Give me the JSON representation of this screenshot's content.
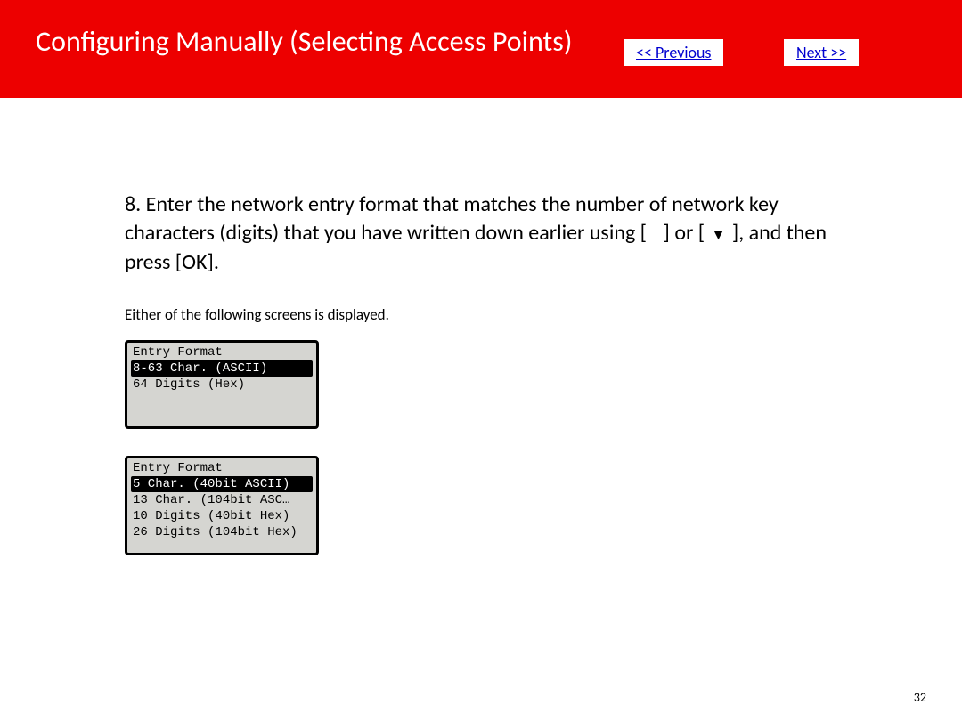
{
  "header": {
    "title": "Configuring Manually (Selecting Access Points)",
    "prev": "<< Previous",
    "next": "Next >>"
  },
  "body": {
    "step_prefix": "8. Enter the network entry format that matches the number of network key characters (digits) that you have written down earlier using [",
    "step_mid1": "] or [",
    "step_mid2": "], and then press [OK].",
    "down_glyph": "▼",
    "note": "Either of the following screens is displayed."
  },
  "lcd1": {
    "title_row": "Entry Format",
    "rows": [
      {
        "text": "8-63 Char. (ASCII)",
        "selected": true
      },
      {
        "text": "64 Digits (Hex)",
        "selected": false
      }
    ]
  },
  "lcd2": {
    "title_row": "Entry Format",
    "rows": [
      {
        "text": "5 Char. (40bit ASCII)",
        "selected": true
      },
      {
        "text": "13 Char. (104bit ASC…",
        "selected": false
      },
      {
        "text": "10 Digits (40bit Hex)",
        "selected": false
      },
      {
        "text": "26 Digits (104bit Hex)",
        "selected": false
      }
    ]
  },
  "footer": {
    "page": "32"
  }
}
